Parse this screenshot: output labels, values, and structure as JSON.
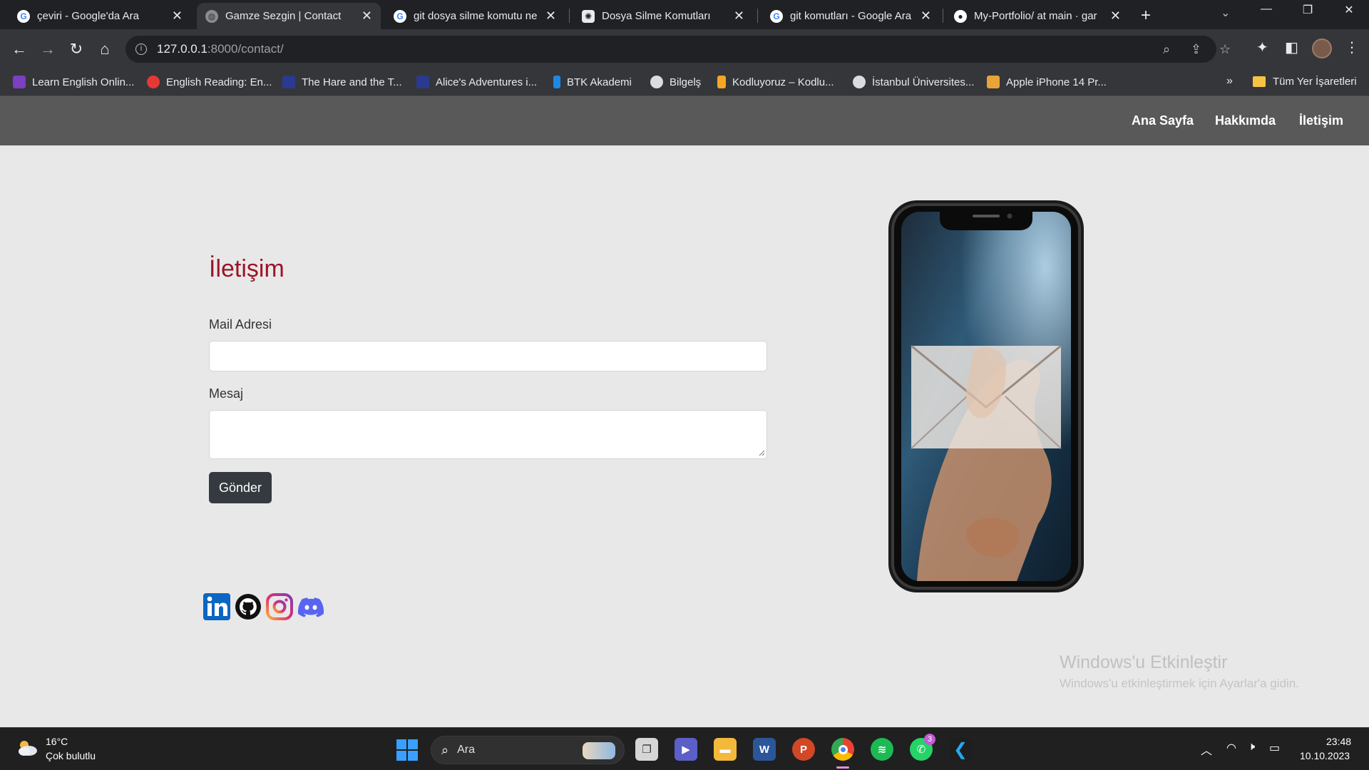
{
  "browser": {
    "tabs": [
      {
        "title": "çeviri - Google'da Ara",
        "icon": "google-icon"
      },
      {
        "title": "Gamze Sezgin | Contact",
        "icon": "globe-icon",
        "active": true
      },
      {
        "title": "git dosya silme komutu ne",
        "icon": "google-icon"
      },
      {
        "title": "Dosya Silme Komutları",
        "icon": "chatgpt-icon"
      },
      {
        "title": "git komutları - Google Ara",
        "icon": "google-icon"
      },
      {
        "title": "My-Portfolio/ at main · gar",
        "icon": "github-icon"
      }
    ],
    "url_host": "127.0.0.1",
    "url_rest": ":8000/contact/",
    "bookmarks": [
      "Learn English Onlin...",
      "English Reading: En...",
      "The Hare and the T...",
      "Alice's Adventures i...",
      "BTK Akademi",
      "Bilgelş",
      "Kodluyoruz – Kodlu...",
      "İstanbul Üniversites...",
      "Apple iPhone 14 Pr..."
    ],
    "bookmarks_more": "»",
    "bookmarks_folder": "Tüm Yer İşaretleri"
  },
  "site": {
    "nav": [
      "Ana Sayfa",
      "Hakkımda",
      "İletişim"
    ],
    "contact_title": "İletişim",
    "email_label": "Mail Adresi",
    "message_label": "Mesaj",
    "email_value": "",
    "message_value": "",
    "send_label": "Gönder",
    "social": [
      "linkedin-icon",
      "github-icon",
      "instagram-icon",
      "discord-icon"
    ]
  },
  "watermark": {
    "title": "Windows'u Etkinleştir",
    "subtitle": "Windows'u etkinleştirmek için Ayarlar'a gidin."
  },
  "taskbar": {
    "temp": "16°C",
    "weather": "Çok bulutlu",
    "search_placeholder": "Ara",
    "whatsapp_badge": "3",
    "time": "23:48",
    "date": "10.10.2023"
  },
  "colors": {
    "title_red": "#9b1427",
    "navbar": "#595959",
    "button_dark": "#343a40",
    "page_bg": "#e8e8e8"
  }
}
